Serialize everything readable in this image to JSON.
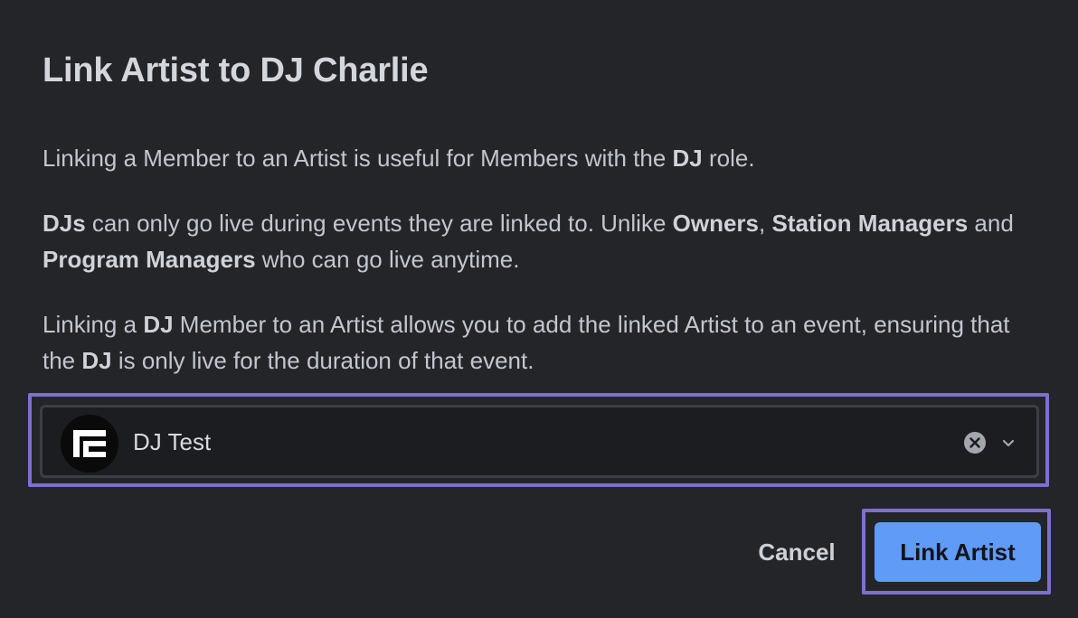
{
  "dialog": {
    "title": "Link Artist to DJ Charlie",
    "paragraph_1": {
      "t1": "Linking a Member to an Artist is useful for Members with the ",
      "b1": "DJ",
      "t2": " role."
    },
    "paragraph_2": {
      "b1": "DJs",
      "t1": " can only go live during events they are linked to. Unlike ",
      "b2": "Owners",
      "t2": ", ",
      "b3": "Station Managers",
      "t3": " and ",
      "b4": "Program Managers",
      "t4": " who can go live anytime."
    },
    "paragraph_3": {
      "t1": "Linking a ",
      "b1": "DJ",
      "t2": " Member to an Artist allows you to add the linked Artist to an event, ensuring that the ",
      "b2": "DJ",
      "t3": " is only live for the duration of that event."
    }
  },
  "artist_select": {
    "selected_value": "DJ Test",
    "avatar_icon": "artist-logo-icon",
    "clear_icon": "clear-circle-x-icon",
    "dropdown_icon": "chevron-down-icon"
  },
  "actions": {
    "cancel_label": "Cancel",
    "confirm_label": "Link Artist"
  },
  "colors": {
    "background": "#232529",
    "primary_button": "#5f9bf7",
    "focus_highlight": "#7f6fd0",
    "select_background": "#1c1d21"
  }
}
